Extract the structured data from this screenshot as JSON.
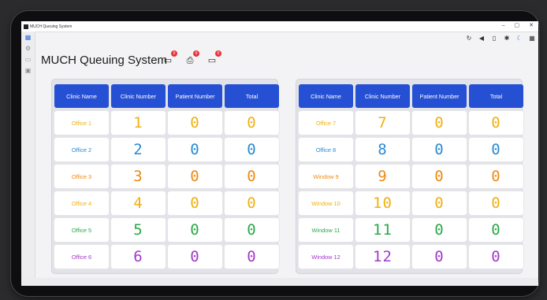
{
  "window": {
    "title": "MUCH Queuing System",
    "controls": [
      "–",
      "▢",
      "✕"
    ]
  },
  "page": {
    "title": "MUCH Queuing System",
    "toolbar_icons": [
      {
        "icon": "monitor-icon",
        "badge": "0"
      },
      {
        "icon": "printer-icon",
        "badge": "0"
      },
      {
        "icon": "display-icon",
        "badge": "0"
      }
    ]
  },
  "top_right_icons": [
    "refresh-icon",
    "volume-icon",
    "phone-icon",
    "accessibility-icon",
    "moon-icon",
    "grid-icon"
  ],
  "sidebar": {
    "items": [
      "dashboard-icon",
      "settings-icon",
      "monitor-icon",
      "card-icon"
    ]
  },
  "table_headers": [
    "Clinic Name",
    "Clinic Number",
    "Patient Number",
    "Total"
  ],
  "left_table": [
    {
      "name": "Office 1",
      "number": "1",
      "patient": "0",
      "total": "0",
      "color": "#f0b010"
    },
    {
      "name": "Office 2",
      "number": "2",
      "patient": "0",
      "total": "0",
      "color": "#2a8ad4"
    },
    {
      "name": "Office 3",
      "number": "3",
      "patient": "0",
      "total": "0",
      "color": "#f08a10"
    },
    {
      "name": "Office 4",
      "number": "4",
      "patient": "0",
      "total": "0",
      "color": "#f0b010"
    },
    {
      "name": "Office 5",
      "number": "5",
      "patient": "0",
      "total": "0",
      "color": "#2aa84a"
    },
    {
      "name": "Office 6",
      "number": "6",
      "patient": "0",
      "total": "0",
      "color": "#a23ac8"
    }
  ],
  "right_table": [
    {
      "name": "Office 7",
      "number": "7",
      "patient": "0",
      "total": "0",
      "color": "#f0b010"
    },
    {
      "name": "Office 8",
      "number": "8",
      "patient": "0",
      "total": "0",
      "color": "#2a8ad4"
    },
    {
      "name": "Window 9",
      "number": "9",
      "patient": "0",
      "total": "0",
      "color": "#f08a10"
    },
    {
      "name": "Window 10",
      "number": "10",
      "patient": "0",
      "total": "0",
      "color": "#f0b010"
    },
    {
      "name": "Window 11",
      "number": "11",
      "patient": "0",
      "total": "0",
      "color": "#2aa84a"
    },
    {
      "name": "Window 12",
      "number": "12",
      "patient": "0",
      "total": "0",
      "color": "#a23ac8"
    }
  ]
}
